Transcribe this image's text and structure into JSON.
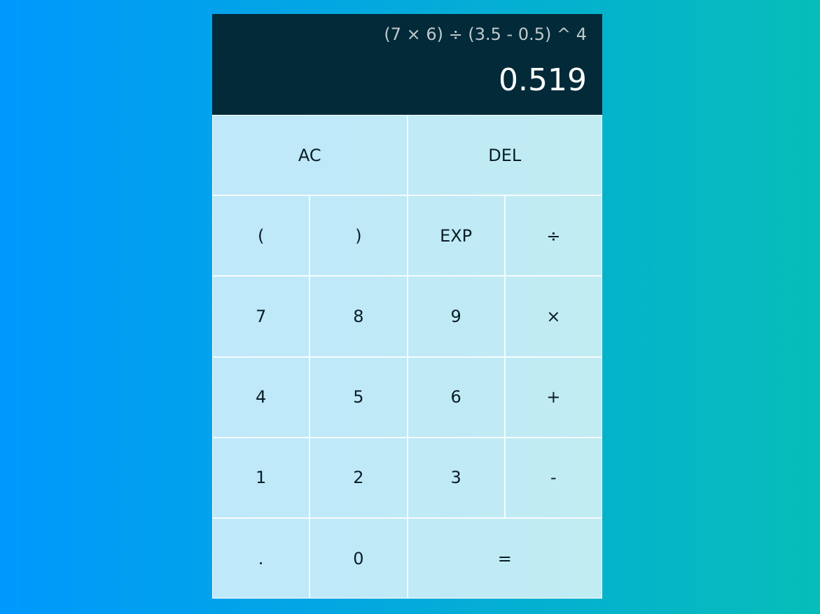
{
  "display": {
    "previous": "(7 × 6) ÷ (3.5 - 0.5) ^ 4",
    "current": "0.519"
  },
  "buttons": [
    {
      "label": "AC",
      "name": "all-clear-button",
      "span": 2
    },
    {
      "label": "DEL",
      "name": "delete-button",
      "span": 2
    },
    {
      "label": "(",
      "name": "open-paren-button"
    },
    {
      "label": ")",
      "name": "close-paren-button"
    },
    {
      "label": "EXP",
      "name": "exponent-button"
    },
    {
      "label": "÷",
      "name": "divide-button"
    },
    {
      "label": "7",
      "name": "digit-7-button"
    },
    {
      "label": "8",
      "name": "digit-8-button"
    },
    {
      "label": "9",
      "name": "digit-9-button"
    },
    {
      "label": "×",
      "name": "multiply-button"
    },
    {
      "label": "4",
      "name": "digit-4-button"
    },
    {
      "label": "5",
      "name": "digit-5-button"
    },
    {
      "label": "6",
      "name": "digit-6-button"
    },
    {
      "label": "+",
      "name": "add-button"
    },
    {
      "label": "1",
      "name": "digit-1-button"
    },
    {
      "label": "2",
      "name": "digit-2-button"
    },
    {
      "label": "3",
      "name": "digit-3-button"
    },
    {
      "label": "-",
      "name": "subtract-button"
    },
    {
      "label": ".",
      "name": "decimal-button"
    },
    {
      "label": "0",
      "name": "digit-0-button"
    },
    {
      "label": "=",
      "name": "equals-button",
      "span": 2
    }
  ],
  "colors": {
    "background_start": "#0098fd",
    "background_end": "#06bdb9",
    "display_bg": "#022a38"
  }
}
